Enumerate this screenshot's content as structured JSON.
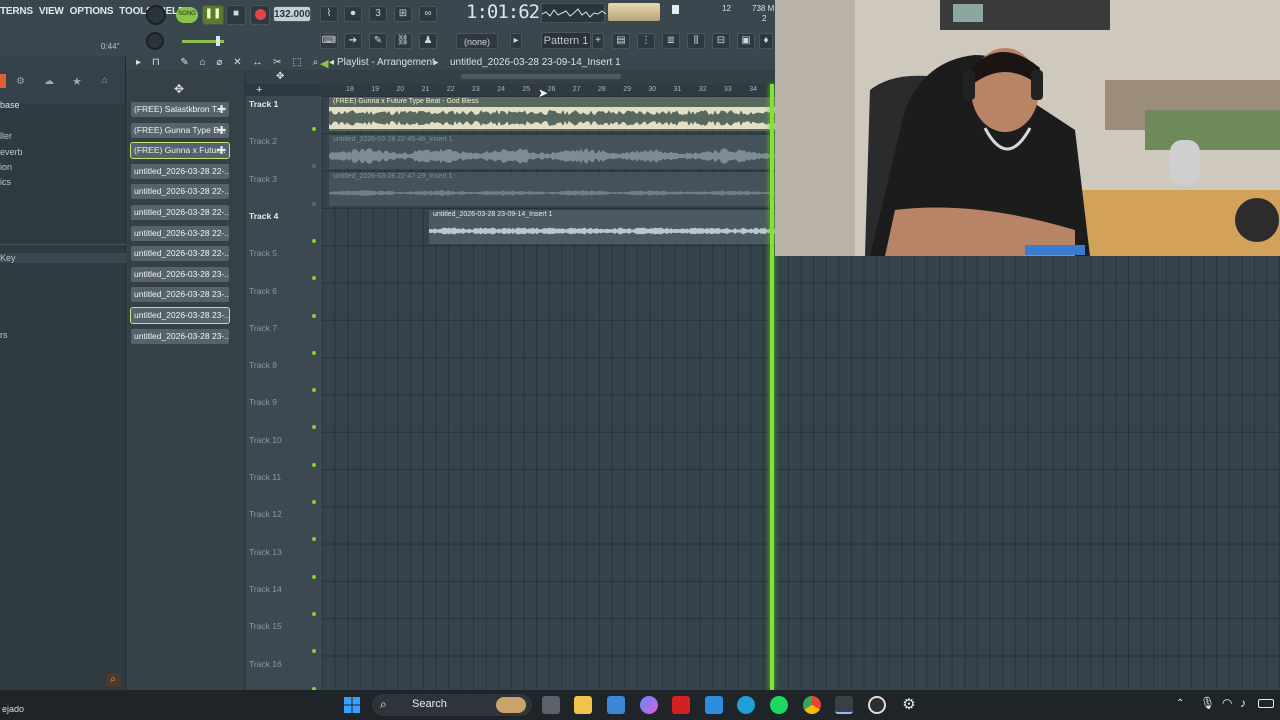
{
  "menu": [
    "TERNS",
    "VIEW",
    "OPTIONS",
    "TOOLS",
    "HELP"
  ],
  "transport": {
    "mode_label": "SONG",
    "tempo": "132.000",
    "timecode": "1:01:62",
    "hint_time": "0:44\"",
    "cpu": "12",
    "memory": "738 M",
    "memory_sub": "2"
  },
  "pattern": {
    "none_label": "(none)",
    "selected": "Pattern 1"
  },
  "playlist": {
    "title": "Playlist - Arrangement",
    "project": "untitled_2026-03-28 23-09-14_Insert 1",
    "ruler": [
      "18",
      "19",
      "20",
      "21",
      "22",
      "23",
      "24",
      "25",
      "26",
      "27",
      "28",
      "29",
      "30",
      "31",
      "32",
      "33",
      "34"
    ]
  },
  "browser": {
    "items": [
      "base",
      "ller",
      "everb",
      "ion",
      "ics",
      "Key",
      "rs"
    ]
  },
  "clips": [
    "(FREE) Salastkbron T...",
    "(FREE) Gunna Type B...",
    "(FREE) Gunna x Futur...",
    "untitled_2026-03-28 22-...",
    "untitled_2026-03-28 22-...",
    "untitled_2026-03-28 22-...",
    "untitled_2026-03-28 22-...",
    "untitled_2026-03-28 22-...",
    "untitled_2026-03-28 23-...",
    "untitled_2026-03-28 23-...",
    "untitled_2026-03-28 23-...",
    "untitled_2026-03-28 23-..."
  ],
  "tracks": [
    "Track 1",
    "Track 2",
    "Track 3",
    "Track 4",
    "Track 5",
    "Track 6",
    "Track 7",
    "Track 8",
    "Track 9",
    "Track 10",
    "Track 11",
    "Track 12",
    "Track 13",
    "Track 14",
    "Track 15",
    "Track 16"
  ],
  "audio_clips": {
    "clip1": "(FREE) Gunna x Future Type Beat - God Bless",
    "clip2": "untitled_2026-03-28 22-45-46_Insert 1",
    "clip3": "untitled_2026-03-28 22-47-29_Insert 1",
    "clip4": "untitled_2026-03-28 23-09-14_Insert 1"
  },
  "taskbar": {
    "search": "Search",
    "left_status": "ejado"
  },
  "colors": {
    "accent": "#86e03a",
    "toolbar": "#3b474f",
    "grid": "#34434c"
  }
}
